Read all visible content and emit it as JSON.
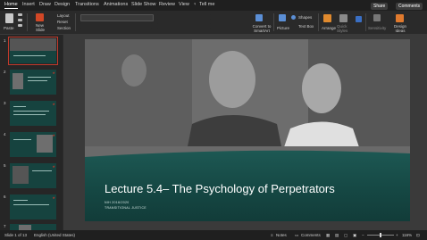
{
  "ribbon": {
    "tabs": [
      "Home",
      "Insert",
      "Draw",
      "Design",
      "Transitions",
      "Animations",
      "Slide Show",
      "Review",
      "View"
    ],
    "tell_me": "Tell me",
    "share": "Share",
    "comments": "Comments",
    "paste": "Paste",
    "new_slide": "New Slide",
    "layout": "Layout",
    "reset": "Reset",
    "section": "Section",
    "convert_to_smartart": "Convert to SmartArt",
    "picture": "Picture",
    "shapes": "Shapes",
    "text_box": "Text Box",
    "arrange": "Arrange",
    "quick_styles": "Quick Styles",
    "sensitivity": "Sensitivity",
    "design_ideas": "Design Ideas"
  },
  "thumbnails": {
    "numbers": [
      "1",
      "2",
      "3",
      "4",
      "5",
      "6",
      "7"
    ]
  },
  "slide": {
    "title": "Lecture 5.4– The Psychology of Perpetrators",
    "subtitle_line1": "NIH 2016/2020",
    "subtitle_line2": "TRANSITIONAL JUSTICE"
  },
  "status": {
    "slide_indicator": "Slide 1 of 13",
    "language": "English (United States)",
    "notes": "Notes",
    "comments": "Comments",
    "zoom": "116%"
  },
  "colors": {
    "accent_orange": "#d24726",
    "slide_teal": "#1c4a47",
    "selection_red": "#c0392b"
  }
}
